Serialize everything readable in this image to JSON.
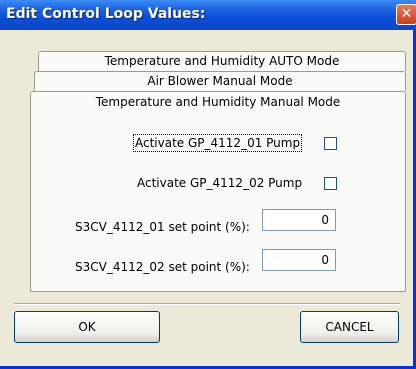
{
  "window": {
    "title": "Edit Control Loop Values:",
    "close_glyph": "✕"
  },
  "tabs": [
    {
      "label": "Temperature and Humidity AUTO Mode"
    },
    {
      "label": "Air Blower Manual Mode"
    },
    {
      "label": "Temperature and Humidity Manual Mode",
      "active": true
    }
  ],
  "panel": {
    "pumps": [
      {
        "label": "Activate GP_4112_01 Pump",
        "checked": false,
        "focused": true
      },
      {
        "label": "Activate GP_4112_02 Pump",
        "checked": false,
        "focused": false
      }
    ],
    "setpoints": [
      {
        "label": "S3CV_4112_01 set point (%):",
        "value": "0"
      },
      {
        "label": "S3CV_4112_02 set point (%):",
        "value": "0"
      }
    ]
  },
  "buttons": {
    "ok_label": "OK",
    "cancel_label": "CANCEL"
  },
  "colors": {
    "titlebar": "#0a4fd8",
    "dialog_bg": "#ece9d8",
    "panel_bg": "#fbfbf9",
    "close_button": "#d0502b"
  }
}
